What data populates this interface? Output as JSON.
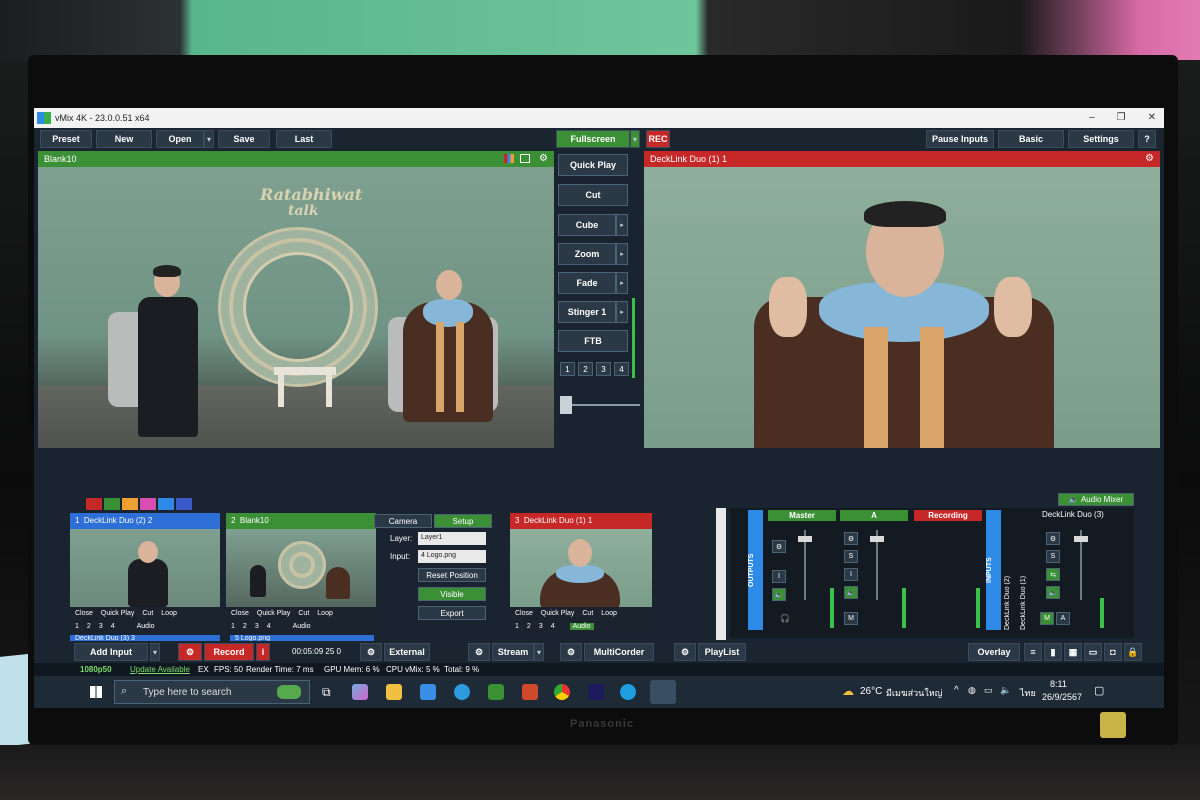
{
  "window": {
    "title": "vMix 4K - 23.0.0.51 x64",
    "controls": [
      "–",
      "❐",
      "✕"
    ]
  },
  "menu": {
    "preset": "Preset",
    "new": "New",
    "open": "Open",
    "save": "Save",
    "last": "Last",
    "fullscreen": "Fullscreen",
    "rec": "REC",
    "pause_inputs": "Pause Inputs",
    "basic": "Basic",
    "settings": "Settings",
    "help": "?"
  },
  "preview": {
    "title": "Blank10",
    "logo_line1": "Ratabhiwat",
    "logo_line2": "talk"
  },
  "output": {
    "title": "DeckLink Duo (1) 1"
  },
  "transitions": {
    "quick_play": "Quick Play",
    "cut": "Cut",
    "cube": "Cube",
    "zoom": "Zoom",
    "fade": "Fade",
    "stinger": "Stinger 1",
    "ftb": "FTB",
    "numbers": [
      "1",
      "2",
      "3",
      "4"
    ]
  },
  "color_tags": [
    "#c62828",
    "#3b8f35",
    "#f0a030",
    "#d84db0",
    "#2d8ae6",
    "#3a58c8"
  ],
  "inputs": [
    {
      "num": "1",
      "name": "DeckLink Duo (2) 2",
      "color": "#2d6fd6"
    },
    {
      "num": "2",
      "name": "Blank10",
      "color": "#3b8f35"
    },
    {
      "num": "3",
      "name": "DeckLink Duo (1) 1",
      "color": "#c62828"
    }
  ],
  "tile_controls": {
    "close": "Close",
    "quick_play": "Quick Play",
    "cut": "Cut",
    "loop": "Loop",
    "audio": "Audio",
    "nums": [
      "1",
      "2",
      "3",
      "4"
    ]
  },
  "input_below": [
    {
      "name": "DeckLink Duo (3) 3"
    },
    {
      "num": "5",
      "name": "Logo.png"
    }
  ],
  "layer_panel": {
    "camera": "Camera",
    "setup": "Setup",
    "layer_label": "Layer:",
    "layer_value": "Layer1",
    "input_label": "Input:",
    "input_value": "4 Logo.png",
    "reset_position": "Reset Position",
    "visible": "Visible",
    "export": "Export"
  },
  "audio_mixer": {
    "title": "Audio Mixer",
    "outputs": "OUTPUTS",
    "inputs": "INPUTS",
    "master": "Master",
    "a": "A",
    "recording": "Recording",
    "ch1": "DeckLink Duo (2)",
    "ch2": "DeckLink Duo (1)",
    "ch3": "DeckLink Duo (3)",
    "s": "S",
    "m": "M",
    "i": "I"
  },
  "toolbar": {
    "add_input": "Add Input",
    "record": "Record",
    "timer": "00:05:09 25 0",
    "external": "External",
    "stream": "Stream",
    "multicorder": "MultiCorder",
    "playlist": "PlayList",
    "overlay": "Overlay"
  },
  "status": {
    "format": "1080p50",
    "update": "Update Available",
    "ex": "EX",
    "fps": "FPS:  50",
    "render": "Render Time:  7 ms",
    "gpu": "GPU Mem:  6 %",
    "cpu": "CPU vMix:  5 %",
    "total": "Total:  9 %"
  },
  "taskbar": {
    "search_placeholder": "Type here to search",
    "weather": "26°C",
    "weather_text": "มีเมฆส่วนใหญ่",
    "lang": "ไทย",
    "time": "8:11",
    "date": "26/9/2567"
  },
  "monitor": {
    "brand": "Panasonic"
  }
}
